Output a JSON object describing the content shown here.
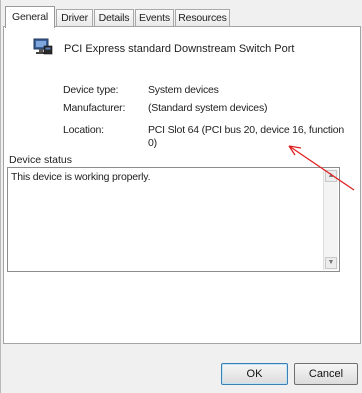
{
  "tabs": [
    {
      "label": "General",
      "active": true
    },
    {
      "label": "Driver",
      "active": false
    },
    {
      "label": "Details",
      "active": false
    },
    {
      "label": "Events",
      "active": false
    },
    {
      "label": "Resources",
      "active": false
    }
  ],
  "device": {
    "name": "PCI Express standard Downstream Switch Port",
    "icon": "device-manager-icon"
  },
  "properties": [
    {
      "label": "Device type:",
      "value": "System devices"
    },
    {
      "label": "Manufacturer:",
      "value": "(Standard system devices)"
    },
    {
      "label": "Location:",
      "value": "PCI Slot 64 (PCI bus 20, device 16, function 0)"
    }
  ],
  "status": {
    "label": "Device status",
    "text": "This device is working properly."
  },
  "buttons": {
    "ok": "OK",
    "cancel": "Cancel"
  },
  "colors": {
    "annotation_arrow": "#e02020"
  }
}
